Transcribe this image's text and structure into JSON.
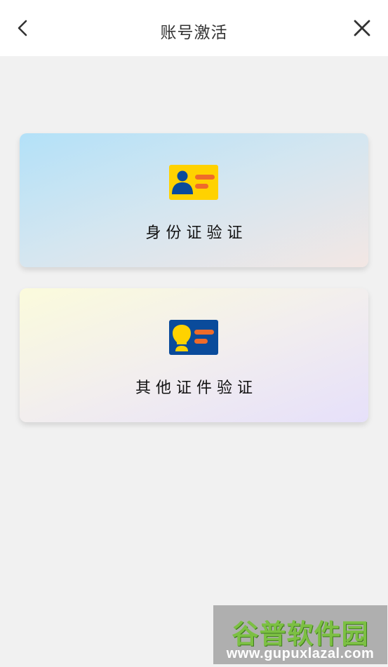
{
  "header": {
    "title": "账号激活",
    "back_icon": "chevron-left-icon",
    "close_icon": "close-icon"
  },
  "cards": [
    {
      "label": "身份证验证",
      "icon": "id-card-icon",
      "colors": {
        "card_bg": "#ffd200",
        "person": "#0a4b9b",
        "lines": "#ef6b2a"
      }
    },
    {
      "label": "其他证件验证",
      "icon": "document-card-icon",
      "colors": {
        "card_bg": "#0a4b9b",
        "person": "#ffd200",
        "lines": "#ef6b2a"
      }
    }
  ],
  "watermark": {
    "title": "谷普软件园",
    "url": "www.gupuxlazal.com"
  }
}
